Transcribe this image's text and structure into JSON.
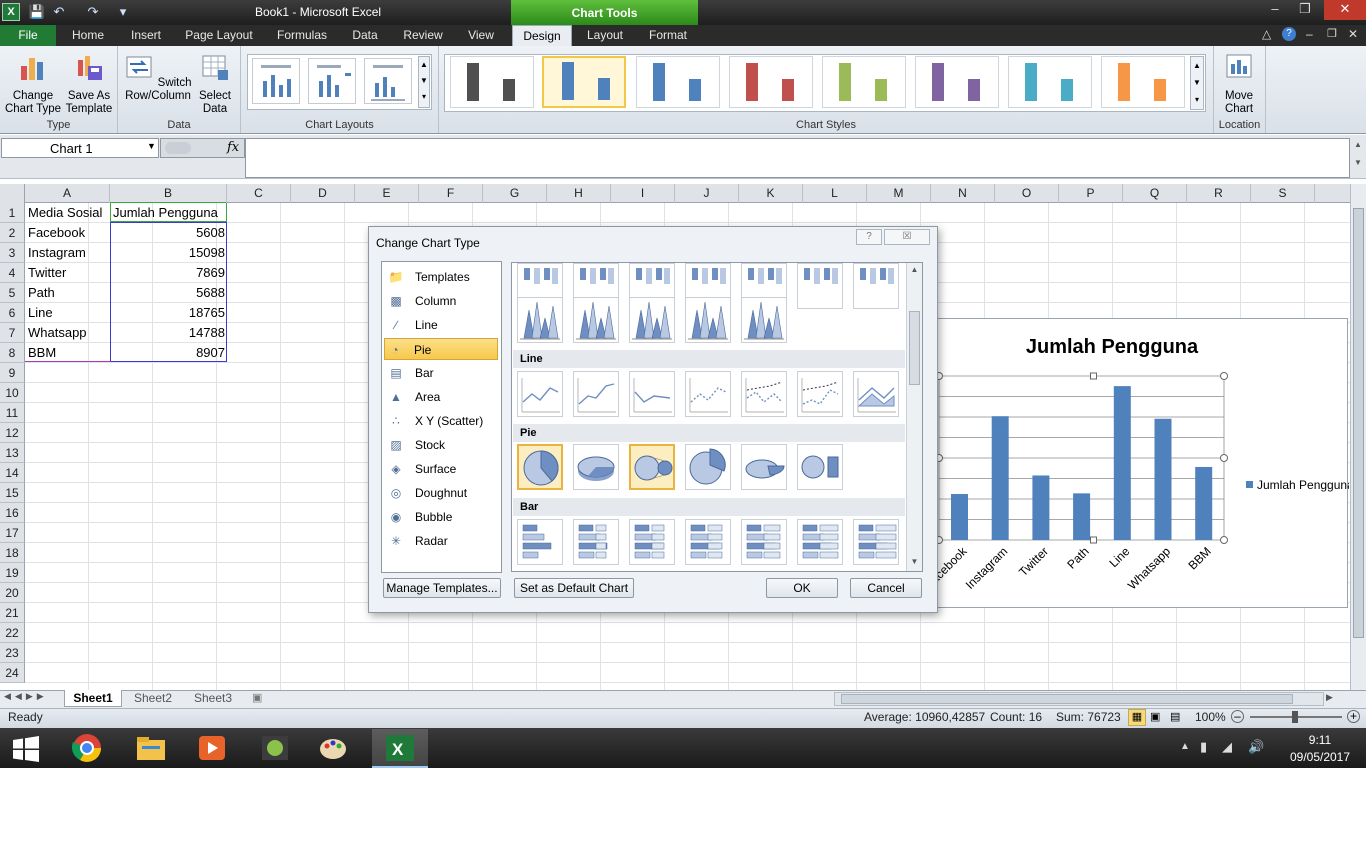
{
  "window": {
    "title": "Book1  -  Microsoft Excel",
    "contextual_header": "Chart Tools"
  },
  "tabs": [
    "File",
    "Home",
    "Insert",
    "Page Layout",
    "Formulas",
    "Data",
    "Review",
    "View",
    "Design",
    "Layout",
    "Format"
  ],
  "ribbon": {
    "type_group": {
      "label": "Type",
      "change_chart_type": "Change\nChart Type",
      "save_as_template": "Save As\nTemplate"
    },
    "data_group": {
      "label": "Data",
      "switch_row_column": "Switch\nRow/Column",
      "select_data": "Select\nData"
    },
    "layouts_group": {
      "label": "Chart Layouts"
    },
    "styles_group": {
      "label": "Chart Styles",
      "style_colors": [
        "#505050",
        "#4f81bd",
        "#4f81bd",
        "#c0504d",
        "#9bbb59",
        "#8064a2",
        "#4bacc6",
        "#f79646"
      ]
    },
    "location_group": {
      "label": "Location",
      "move_chart": "Move\nChart"
    }
  },
  "formula_bar": {
    "name_box": "Chart 1",
    "fx": "fx"
  },
  "columns": [
    "A",
    "B",
    "C",
    "D",
    "E",
    "F",
    "G",
    "H",
    "I",
    "J",
    "K",
    "L",
    "M",
    "N",
    "O",
    "P",
    "Q",
    "R",
    "S"
  ],
  "rows": [
    "1",
    "2",
    "3",
    "4",
    "5",
    "6",
    "7",
    "8",
    "9",
    "10",
    "11",
    "12",
    "13",
    "14",
    "15",
    "16",
    "17",
    "18",
    "19",
    "20",
    "21",
    "22",
    "23",
    "24"
  ],
  "sheet": {
    "header": [
      "Media Sosial",
      "Jumlah Pengguna"
    ],
    "data": [
      [
        "Facebook",
        "5608"
      ],
      [
        "Instagram",
        "15098"
      ],
      [
        "Twitter",
        "7869"
      ],
      [
        "Path",
        "5688"
      ],
      [
        "Line",
        "18765"
      ],
      [
        "Whatsapp",
        "14788"
      ],
      [
        "BBM",
        "8907"
      ]
    ]
  },
  "sheet_tabs": [
    "Sheet1",
    "Sheet2",
    "Sheet3"
  ],
  "status": {
    "ready": "Ready",
    "average": "Average: 10960,42857",
    "count": "Count: 16",
    "sum": "Sum: 76723",
    "zoom": "100%"
  },
  "taskbar": {
    "time": "9:11",
    "date": "09/05/2017"
  },
  "dialog": {
    "title": "Change Chart Type",
    "help": "?",
    "close": "☒",
    "categories": [
      "Templates",
      "Column",
      "Line",
      "Pie",
      "Bar",
      "Area",
      "X Y (Scatter)",
      "Stock",
      "Surface",
      "Doughnut",
      "Bubble",
      "Radar"
    ],
    "selected_category": "Pie",
    "sections": {
      "line": "Line",
      "pie": "Pie",
      "bar": "Bar"
    },
    "manage_templates": "Manage Templates...",
    "set_default": "Set as Default Chart",
    "ok": "OK",
    "cancel": "Cancel"
  },
  "chart_data": {
    "type": "bar",
    "title": "Jumlah Pengguna",
    "categories": [
      "Facebook",
      "Instagram",
      "Twitter",
      "Path",
      "Line",
      "Whatsapp",
      "BBM"
    ],
    "series": [
      {
        "name": "Jumlah Pengguna",
        "values": [
          5608,
          15098,
          7869,
          5688,
          18765,
          14788,
          8907
        ],
        "color": "#4f81bd"
      }
    ],
    "ylim": [
      0,
      20000
    ],
    "grid": true,
    "legend": "right"
  }
}
